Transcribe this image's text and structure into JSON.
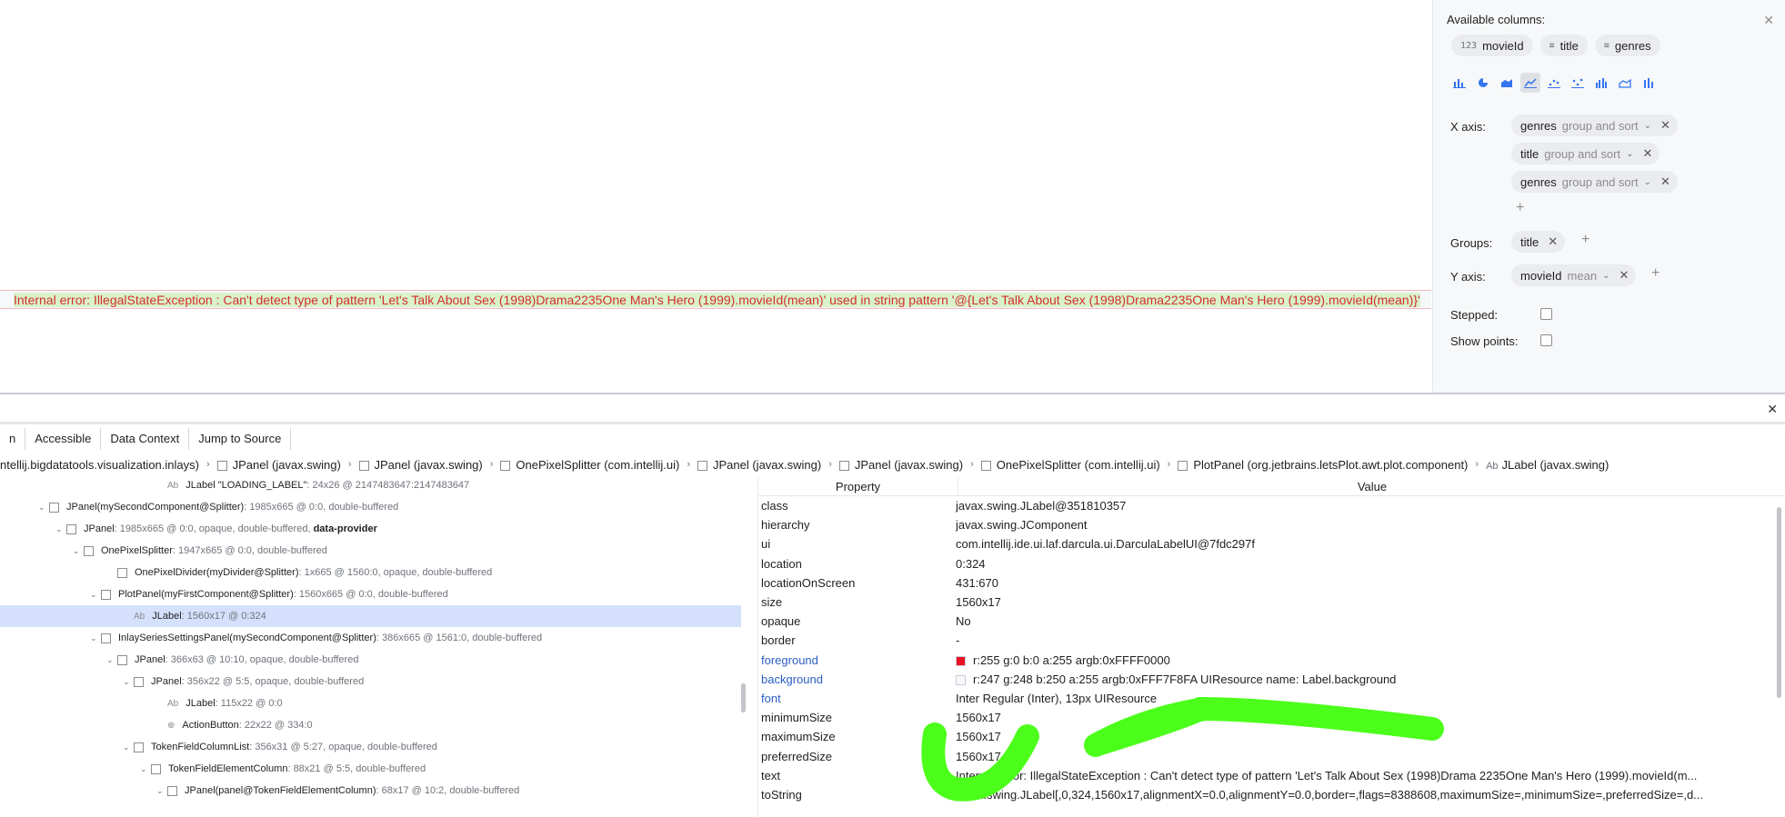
{
  "plot": {
    "error_text": "Internal error: IllegalStateException : Can't detect type of pattern 'Let's Talk About Sex (1998)Drama2235One Man's Hero (1999).movieId(mean)' used in string pattern '@{Let's Talk About Sex (1998)Drama2235One Man's Hero (1999).movieId(mean)}'"
  },
  "settings": {
    "available_title": "Available columns:",
    "close_icon": "close-icon",
    "columns": [
      {
        "icon": "123",
        "label": "movieId"
      },
      {
        "icon": "≡",
        "label": "title"
      },
      {
        "icon": "≡",
        "label": "genres"
      }
    ],
    "chart_types": [
      "bar-chart-icon",
      "pie-chart-icon",
      "area-chart-icon",
      "line-chart-icon",
      "scatter-icon",
      "dot-chart-icon",
      "histogram-icon",
      "area2-icon",
      "bar2-icon"
    ],
    "selected_chart_type_index": 3,
    "x_axis_label": "X axis:",
    "x_axis_tokens": [
      {
        "name": "genres",
        "mode": "group and sort"
      },
      {
        "name": "title",
        "mode": "group and sort"
      },
      {
        "name": "genres",
        "mode": "group and sort"
      }
    ],
    "groups_label": "Groups:",
    "groups_token": "title",
    "y_axis_label": "Y axis:",
    "y_axis_token": {
      "name": "movieId",
      "mode": "mean"
    },
    "stepped_label": "Stepped:",
    "show_points_label": "Show points:"
  },
  "inspector": {
    "toolbar": [
      "n",
      "Accessible",
      "Data Context",
      "Jump to Source"
    ],
    "breadcrumb": [
      {
        "text": "ntellij.bigdatatools.visualization.inlays)",
        "box": false,
        "ab": false
      },
      {
        "text": "JPanel (javax.swing)",
        "box": true,
        "ab": false
      },
      {
        "text": "JPanel (javax.swing)",
        "box": true,
        "ab": false
      },
      {
        "text": "OnePixelSplitter (com.intellij.ui)",
        "box": true,
        "ab": false
      },
      {
        "text": "JPanel (javax.swing)",
        "box": true,
        "ab": false
      },
      {
        "text": "JPanel (javax.swing)",
        "box": true,
        "ab": false
      },
      {
        "text": "OnePixelSplitter (com.intellij.ui)",
        "box": true,
        "ab": false
      },
      {
        "text": "PlotPanel (org.jetbrains.letsPlot.awt.plot.component)",
        "box": true,
        "ab": false
      },
      {
        "text": "JLabel (javax.swing)",
        "box": false,
        "ab": true
      }
    ],
    "tree": [
      {
        "indent": 186,
        "kind": "ab",
        "name": "JLabel \"LOADING_LABEL\"",
        "info": ": 24x26 @ 2147483647:2147483647",
        "expand": "",
        "selected": false
      },
      {
        "indent": 56,
        "kind": "box",
        "name": "JPanel(mySecondComponent@Splitter)",
        "info": ": 1985x665 @ 0:0, double-buffered",
        "expand": "⌄",
        "selected": false
      },
      {
        "indent": 75,
        "kind": "box",
        "name": "JPanel",
        "info": ": 1985x665 @ 0:0, opaque, double-buffered, ",
        "bold": "data-provider",
        "expand": "⌄",
        "selected": false
      },
      {
        "indent": 94,
        "kind": "box",
        "name": "OnePixelSplitter",
        "info": ": 1947x665 @ 0:0, double-buffered",
        "expand": "⌄",
        "selected": false
      },
      {
        "indent": 131,
        "kind": "box",
        "name": "OnePixelDivider(myDivider@Splitter)",
        "info": ": 1x665 @ 1560:0, opaque, double-buffered",
        "expand": "",
        "selected": false
      },
      {
        "indent": 113,
        "kind": "box",
        "name": "PlotPanel(myFirstComponent@Splitter)",
        "info": ": 1560x665 @ 0:0, double-buffered",
        "expand": "⌄",
        "selected": false
      },
      {
        "indent": 149,
        "kind": "ab",
        "name": "JLabel",
        "info": ": 1560x17 @ 0:324",
        "expand": "",
        "selected": true
      },
      {
        "indent": 113,
        "kind": "box",
        "name": "InlaySeriesSettingsPanel(mySecondComponent@Splitter)",
        "info": ": 386x665 @ 1561:0, double-buffered",
        "expand": "⌄",
        "selected": false
      },
      {
        "indent": 131,
        "kind": "box",
        "name": "JPanel",
        "info": ": 366x63 @ 10:10, opaque, double-buffered",
        "expand": "⌄",
        "selected": false
      },
      {
        "indent": 149,
        "kind": "box",
        "name": "JPanel",
        "info": ": 356x22 @ 5:5, opaque, double-buffered",
        "expand": "⌄",
        "selected": false
      },
      {
        "indent": 186,
        "kind": "ab",
        "name": "JLabel",
        "info": ": 115x22 @ 0:0",
        "expand": "",
        "selected": false
      },
      {
        "indent": 186,
        "kind": "action",
        "name": "ActionButton",
        "info": ": 22x22 @ 334:0",
        "expand": "",
        "selected": false
      },
      {
        "indent": 149,
        "kind": "box",
        "name": "TokenFieldColumnList",
        "info": ": 356x31 @ 5:27, opaque, double-buffered",
        "expand": "⌄",
        "selected": false
      },
      {
        "indent": 168,
        "kind": "box",
        "name": "TokenFieldElementColumn",
        "info": ": 88x21 @ 5:5, double-buffered",
        "expand": "⌄",
        "selected": false
      },
      {
        "indent": 186,
        "kind": "box",
        "name": "JPanel(panel@TokenFieldElementColumn)",
        "info": ": 68x17 @ 10:2, double-buffered",
        "expand": "⌄",
        "selected": false
      }
    ],
    "props_header": {
      "property": "Property",
      "value": "Value"
    },
    "props": [
      {
        "name": "class",
        "value": "javax.swing.JLabel@351810357",
        "blue": false
      },
      {
        "name": "hierarchy",
        "value": "javax.swing.JComponent",
        "blue": false
      },
      {
        "name": "ui",
        "value": "com.intellij.ide.ui.laf.darcula.ui.DarculaLabelUI@7fdc297f",
        "blue": false
      },
      {
        "name": "location",
        "value": "0:324",
        "blue": false
      },
      {
        "name": "locationOnScreen",
        "value": "431:670",
        "blue": false
      },
      {
        "name": "size",
        "value": "1560x17",
        "blue": false
      },
      {
        "name": "opaque",
        "value": "No",
        "blue": false
      },
      {
        "name": "border",
        "value": "-",
        "blue": false
      },
      {
        "name": "foreground",
        "value": "r:255 g:0 b:0 a:255 argb:0xFFFF0000",
        "blue": true,
        "swatch": "#e81123"
      },
      {
        "name": "background",
        "value": "r:247 g:248 b:250 a:255 argb:0xFFF7F8FA UIResource name: Label.background",
        "blue": true,
        "swatch": "#f7f8fa"
      },
      {
        "name": "font",
        "value": "Inter Regular (Inter), 13px UIResource",
        "blue": true
      },
      {
        "name": "minimumSize",
        "value": "1560x17",
        "blue": false
      },
      {
        "name": "maximumSize",
        "value": "1560x17",
        "blue": false
      },
      {
        "name": "preferredSize",
        "value": "1560x17",
        "blue": false
      },
      {
        "name": "text",
        "value": "Internal error: IllegalStateException : Can't detect type of pattern 'Let's Talk About Sex (1998)Drama 2235One Man's Hero (1999).movieId(m...",
        "blue": false
      },
      {
        "name": "toString",
        "value": "javax.swing.JLabel[,0,324,1560x17,alignmentX=0.0,alignmentY=0.0,border=,flags=8388608,maximumSize=,minimumSize=,preferredSize=,d...",
        "blue": false
      }
    ]
  },
  "colors": {
    "scribble": "#4cff1a",
    "error_text": "#d32f2f",
    "accent": "#3574f0",
    "selection": "#d5e1fc"
  }
}
